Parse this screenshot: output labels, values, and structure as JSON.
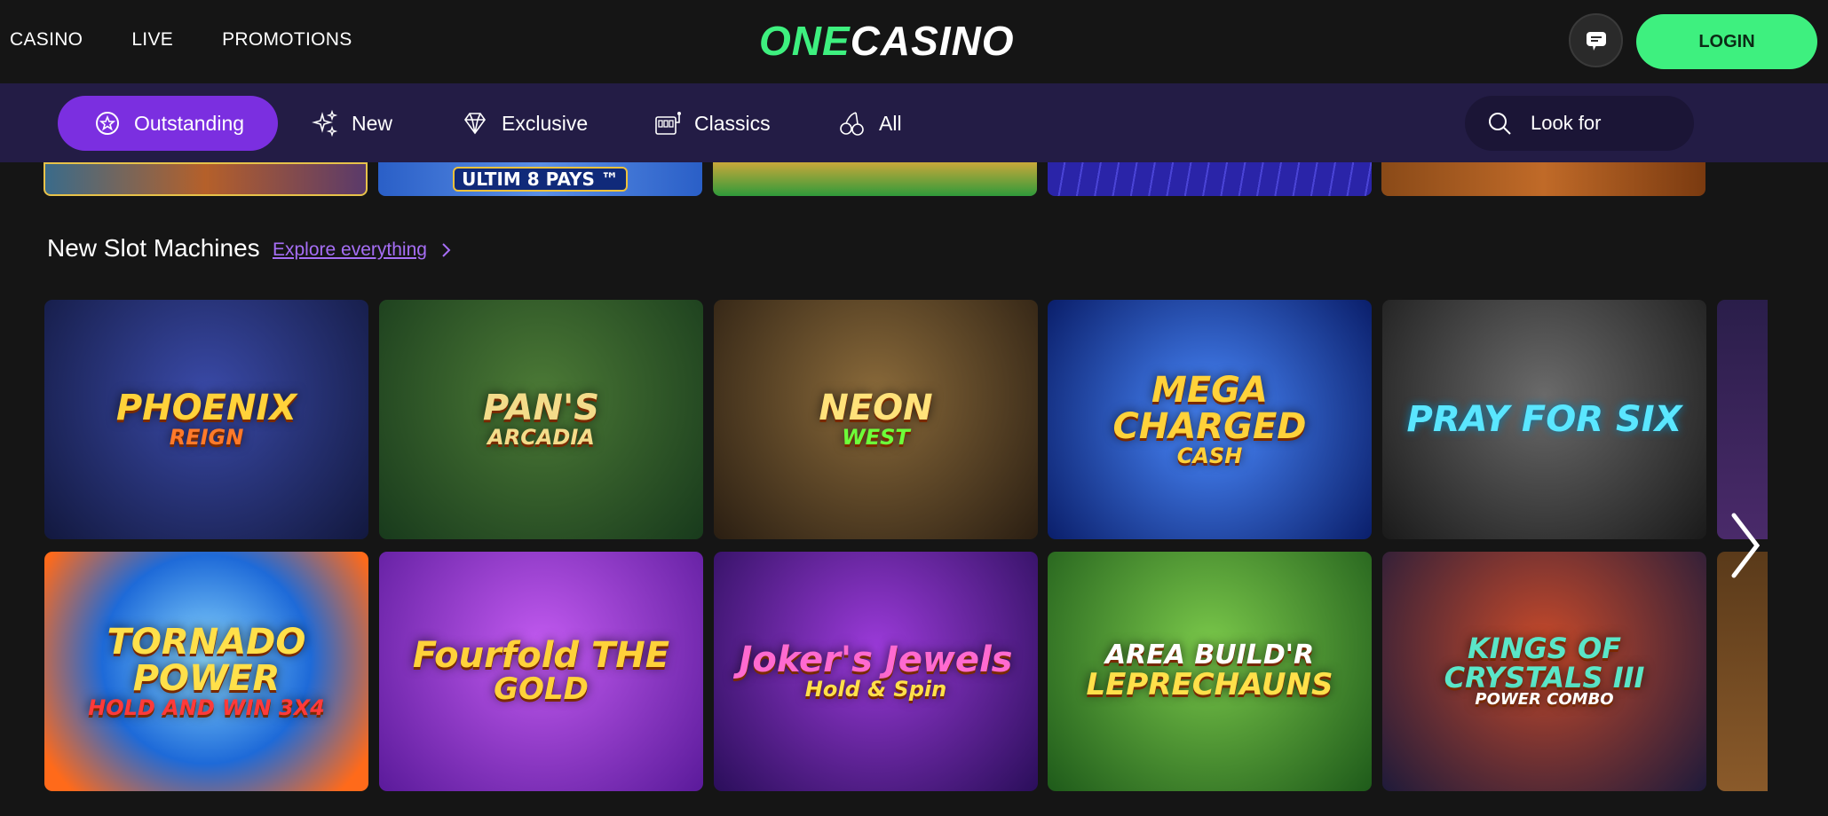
{
  "header": {
    "nav": [
      "CASINO",
      "LIVE",
      "PROMOTIONS"
    ],
    "logo": {
      "prefix": "ONE",
      "suffix": "CASINO"
    },
    "login_label": "LOGIN"
  },
  "categories": [
    {
      "label": "Outstanding",
      "icon": "star-badge-icon",
      "active": true
    },
    {
      "label": "New",
      "icon": "sparkle-icon",
      "active": false
    },
    {
      "label": "Exclusive",
      "icon": "diamond-icon",
      "active": false
    },
    {
      "label": "Classics",
      "icon": "slot-machine-icon",
      "active": false
    },
    {
      "label": "All",
      "icon": "cherries-icon",
      "active": false
    }
  ],
  "search": {
    "placeholder": "Look for"
  },
  "top_row_partial": {
    "tile2_text": "ULTIM 8 PAYS ™"
  },
  "section": {
    "title": "New Slot Machines",
    "explore_label": "Explore everything"
  },
  "games_row1": [
    {
      "title": "PHOENIX",
      "sub": "REIGN"
    },
    {
      "title": "PAN'S",
      "sub": "ARCADIA"
    },
    {
      "title": "NEON",
      "sub": "WEST"
    },
    {
      "title": "MEGA CHARGED",
      "sub": "CASH"
    },
    {
      "title": "PRAY FOR SIX",
      "sub": ""
    }
  ],
  "games_row2": [
    {
      "title": "TORNADO POWER",
      "sub": "HOLD AND WIN 3X4"
    },
    {
      "title": "Fourfold THE",
      "sub": "GOLD"
    },
    {
      "title": "Joker's Jewels",
      "sub": "Hold & Spin"
    },
    {
      "title": "AREA BUILD'R",
      "sub": "LEPRECHAUNS"
    },
    {
      "title": "KINGS OF CRYSTALS III",
      "sub": "POWER COMBO"
    }
  ],
  "colors": {
    "accent_green": "#3ef07f",
    "accent_purple": "#7b2fe0",
    "category_bar": "#231c45",
    "background": "#151515",
    "link_purple": "#a66ef5"
  }
}
